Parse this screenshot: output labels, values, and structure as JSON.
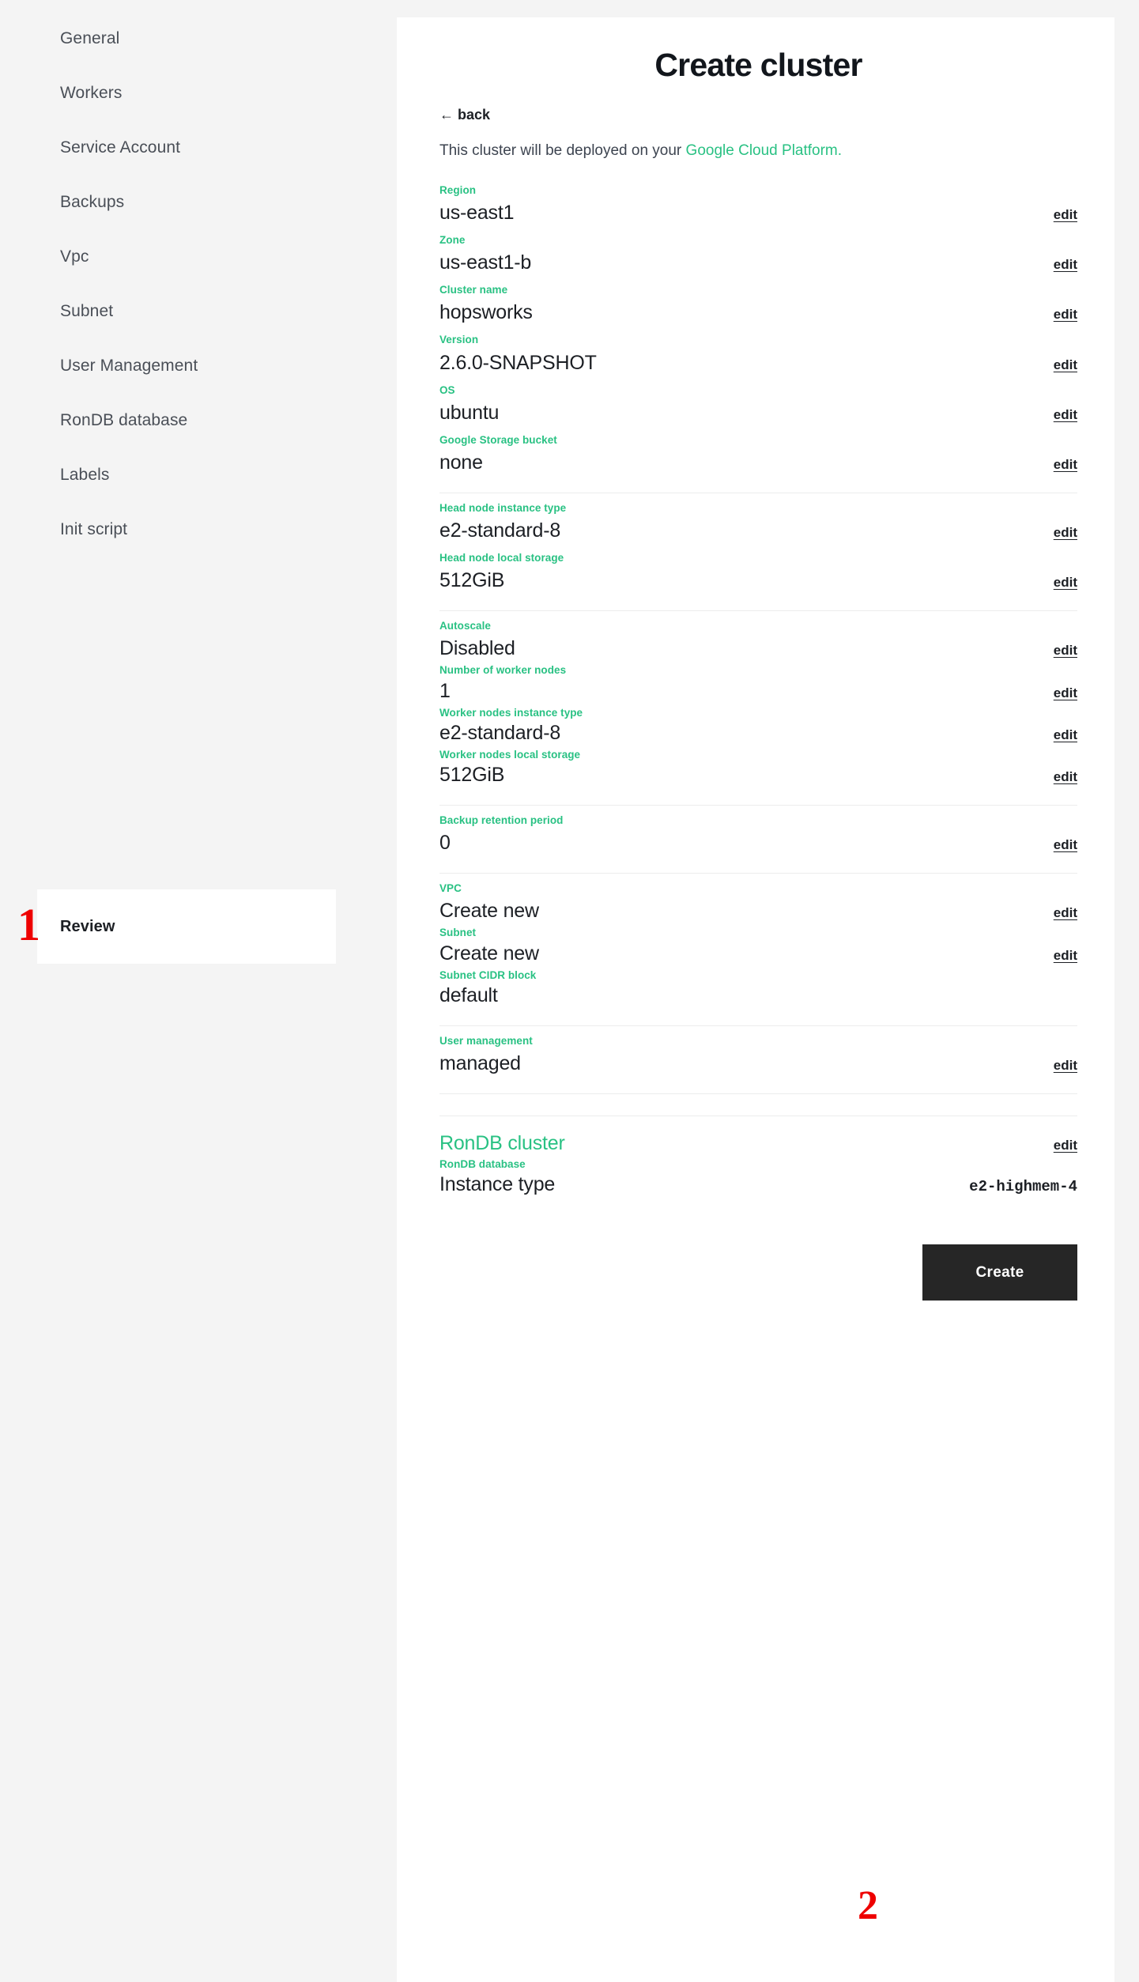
{
  "sidebar": {
    "items": [
      {
        "label": "General",
        "active": false
      },
      {
        "label": "Workers",
        "active": false
      },
      {
        "label": "Service Account",
        "active": false
      },
      {
        "label": "Backups",
        "active": false
      },
      {
        "label": "Vpc",
        "active": false
      },
      {
        "label": "Subnet",
        "active": false
      },
      {
        "label": "User Management",
        "active": false
      },
      {
        "label": "RonDB database",
        "active": false
      },
      {
        "label": "Labels",
        "active": false
      },
      {
        "label": "Init script",
        "active": false
      },
      {
        "label": "Review",
        "active": true
      }
    ]
  },
  "annotations": {
    "marker_1": "1",
    "marker_2": "2"
  },
  "main": {
    "title": "Create cluster",
    "back_label": "← back",
    "deploy_note_prefix": "This cluster will be deployed on your ",
    "deploy_note_provider": "Google Cloud Platform.",
    "edit_label": "edit",
    "fields": [
      {
        "label": "Region",
        "value": "us-east1",
        "edit": "edit"
      },
      {
        "label": "Zone",
        "value": "us-east1-b",
        "edit": "edit"
      },
      {
        "label": "Cluster name",
        "value": "hopsworks",
        "edit": "edit"
      },
      {
        "label": "Version",
        "value": "2.6.0-SNAPSHOT",
        "edit": "edit"
      },
      {
        "label": "OS",
        "value": "ubuntu",
        "edit": "edit"
      },
      {
        "label": "Google Storage bucket",
        "value": "none",
        "edit": "edit"
      },
      {
        "label": "Head node instance type",
        "value": "e2-standard-8",
        "edit": "edit"
      },
      {
        "label": "Head node local storage",
        "value": "512GiB",
        "edit": "edit"
      },
      {
        "label": "Autoscale",
        "value": "Disabled",
        "edit": "edit"
      },
      {
        "label": "Number of worker nodes",
        "value": "1",
        "edit": "edit"
      },
      {
        "label": "Worker nodes instance type",
        "value": "e2-standard-8",
        "edit": "edit"
      },
      {
        "label": "Worker nodes local storage",
        "value": "512GiB",
        "edit": "edit"
      },
      {
        "label": "Backup retention period",
        "value": "0",
        "edit": "edit"
      },
      {
        "label": "VPC",
        "value": "Create new",
        "edit": "edit"
      },
      {
        "label": "Subnet",
        "value": "Create new",
        "edit": "edit"
      },
      {
        "label": "Subnet CIDR block",
        "value": "default",
        "edit": ""
      },
      {
        "label": "User management",
        "value": "managed",
        "edit": "edit"
      }
    ],
    "rondb": {
      "section_title": "RonDB cluster",
      "section_edit": "edit",
      "label": "RonDB database",
      "row_label": "Instance type",
      "row_value": "e2-highmem-4"
    },
    "create_label": "Create"
  },
  "colors": {
    "accent_green": "#29c183",
    "page_bg": "#f4f4f4",
    "panel_bg": "#ffffff",
    "button_bg": "#262626",
    "marker_red": "#ee0000"
  }
}
